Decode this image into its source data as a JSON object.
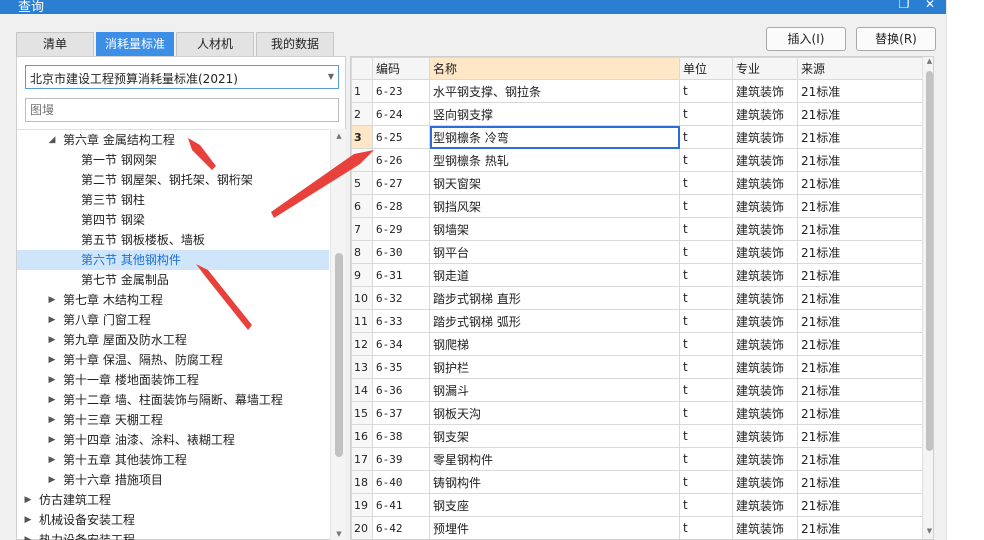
{
  "window": {
    "title": "查询",
    "restore_glyph": "❐",
    "close_glyph": "✕"
  },
  "tabs": [
    {
      "label": "清单",
      "active": false
    },
    {
      "label": "消耗量标准",
      "active": true
    },
    {
      "label": "人材机",
      "active": false
    },
    {
      "label": "我的数据",
      "active": false
    }
  ],
  "toolbar": {
    "insert_label": "插入(I)",
    "replace_label": "替换(R)"
  },
  "standard_select": {
    "value": "北京市建设工程预算消耗量标准(2021)"
  },
  "search": {
    "placeholder": "图墁"
  },
  "tree": [
    {
      "label": "第六章 金属结构工程",
      "level": 2,
      "arrow": "◢",
      "selected": false
    },
    {
      "label": "第一节 钢网架",
      "level": 3,
      "arrow": "",
      "selected": false
    },
    {
      "label": "第二节 钢屋架、钢托架、钢桁架",
      "level": 3,
      "arrow": "",
      "selected": false
    },
    {
      "label": "第三节 钢柱",
      "level": 3,
      "arrow": "",
      "selected": false
    },
    {
      "label": "第四节 钢梁",
      "level": 3,
      "arrow": "",
      "selected": false
    },
    {
      "label": "第五节 钢板楼板、墙板",
      "level": 3,
      "arrow": "",
      "selected": false
    },
    {
      "label": "第六节 其他钢构件",
      "level": 3,
      "arrow": "",
      "selected": true
    },
    {
      "label": "第七节 金属制品",
      "level": 3,
      "arrow": "",
      "selected": false
    },
    {
      "label": "第七章 木结构工程",
      "level": 2,
      "arrow": "▶",
      "selected": false
    },
    {
      "label": "第八章 门窗工程",
      "level": 2,
      "arrow": "▶",
      "selected": false
    },
    {
      "label": "第九章 屋面及防水工程",
      "level": 2,
      "arrow": "▶",
      "selected": false
    },
    {
      "label": "第十章 保温、隔热、防腐工程",
      "level": 2,
      "arrow": "▶",
      "selected": false
    },
    {
      "label": "第十一章 楼地面装饰工程",
      "level": 2,
      "arrow": "▶",
      "selected": false
    },
    {
      "label": "第十二章 墙、柱面装饰与隔断、幕墙工程",
      "level": 2,
      "arrow": "▶",
      "selected": false
    },
    {
      "label": "第十三章 天棚工程",
      "level": 2,
      "arrow": "▶",
      "selected": false
    },
    {
      "label": "第十四章 油漆、涂料、裱糊工程",
      "level": 2,
      "arrow": "▶",
      "selected": false
    },
    {
      "label": "第十五章 其他装饰工程",
      "level": 2,
      "arrow": "▶",
      "selected": false
    },
    {
      "label": "第十六章 措施项目",
      "level": 2,
      "arrow": "▶",
      "selected": false
    },
    {
      "label": "仿古建筑工程",
      "level": 1,
      "arrow": "▶",
      "selected": false
    },
    {
      "label": "机械设备安装工程",
      "level": 1,
      "arrow": "▶",
      "selected": false
    },
    {
      "label": "热力设备安装工程",
      "level": 1,
      "arrow": "▶",
      "selected": false
    }
  ],
  "grid": {
    "columns": [
      "",
      "编码",
      "名称",
      "单位",
      "专业",
      "来源"
    ],
    "rows": [
      [
        "1",
        "6-23",
        "水平钢支撑、钢拉条",
        "t",
        "建筑装饰",
        "21标准"
      ],
      [
        "2",
        "6-24",
        "竖向钢支撑",
        "t",
        "建筑装饰",
        "21标准"
      ],
      [
        "3",
        "6-25",
        "型钢檩条 冷弯",
        "t",
        "建筑装饰",
        "21标准"
      ],
      [
        "4",
        "6-26",
        "型钢檩条 热轧",
        "t",
        "建筑装饰",
        "21标准"
      ],
      [
        "5",
        "6-27",
        "钢天窗架",
        "t",
        "建筑装饰",
        "21标准"
      ],
      [
        "6",
        "6-28",
        "钢挡风架",
        "t",
        "建筑装饰",
        "21标准"
      ],
      [
        "7",
        "6-29",
        "钢墙架",
        "t",
        "建筑装饰",
        "21标准"
      ],
      [
        "8",
        "6-30",
        "钢平台",
        "t",
        "建筑装饰",
        "21标准"
      ],
      [
        "9",
        "6-31",
        "钢走道",
        "t",
        "建筑装饰",
        "21标准"
      ],
      [
        "10",
        "6-32",
        "踏步式钢梯 直形",
        "t",
        "建筑装饰",
        "21标准"
      ],
      [
        "11",
        "6-33",
        "踏步式钢梯 弧形",
        "t",
        "建筑装饰",
        "21标准"
      ],
      [
        "12",
        "6-34",
        "钢爬梯",
        "t",
        "建筑装饰",
        "21标准"
      ],
      [
        "13",
        "6-35",
        "钢护栏",
        "t",
        "建筑装饰",
        "21标准"
      ],
      [
        "14",
        "6-36",
        "钢漏斗",
        "t",
        "建筑装饰",
        "21标准"
      ],
      [
        "15",
        "6-37",
        "钢板天沟",
        "t",
        "建筑装饰",
        "21标准"
      ],
      [
        "16",
        "6-38",
        "钢支架",
        "t",
        "建筑装饰",
        "21标准"
      ],
      [
        "17",
        "6-39",
        "零星钢构件",
        "t",
        "建筑装饰",
        "21标准"
      ],
      [
        "18",
        "6-40",
        "铸钢构件",
        "t",
        "建筑装饰",
        "21标准"
      ],
      [
        "19",
        "6-41",
        "钢支座",
        "t",
        "建筑装饰",
        "21标准"
      ],
      [
        "20",
        "6-42",
        "预埋件",
        "t",
        "建筑装饰",
        "21标准"
      ]
    ],
    "current_row": 3
  },
  "annotation_color": "#e8413b"
}
